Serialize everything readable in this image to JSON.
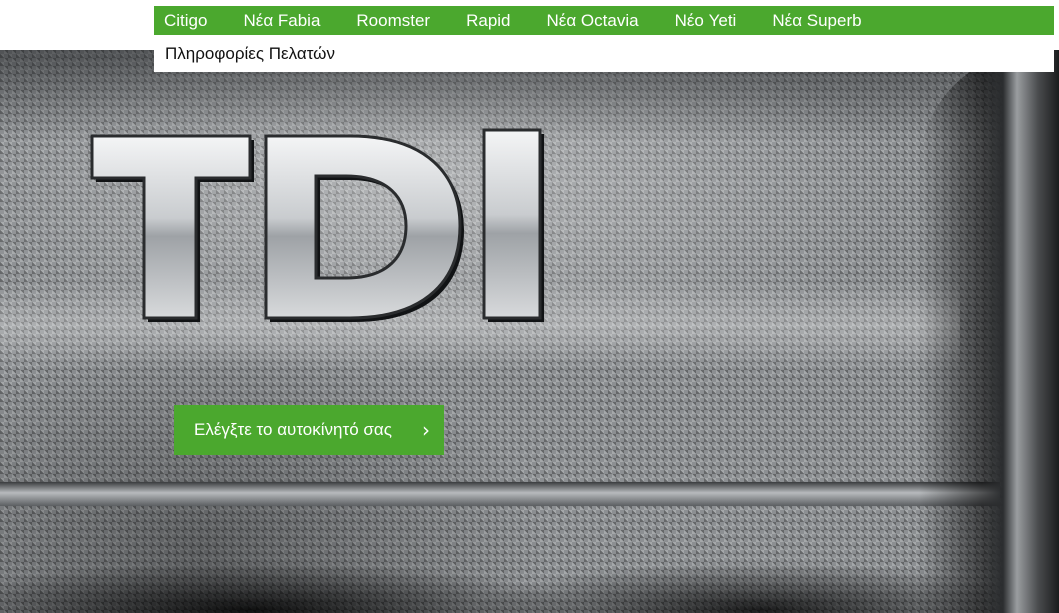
{
  "nav": {
    "items": [
      {
        "label": "Citigo"
      },
      {
        "label": "Νέα Fabia"
      },
      {
        "label": "Roomster"
      },
      {
        "label": "Rapid"
      },
      {
        "label": "Νέα Octavia"
      },
      {
        "label": "Νέο Yeti"
      },
      {
        "label": "Νέα Superb"
      }
    ],
    "sub_items": [
      {
        "label": "Πληροφορίες Πελατών"
      }
    ]
  },
  "hero": {
    "emblem_text": "TDI",
    "cta_label": "Ελέγξτε το αυτοκίνητό σας",
    "cta_icon": "chevron-right-icon"
  },
  "colors": {
    "brand_green": "#4ba82e",
    "nav_text": "#ffffff",
    "subnav_text": "#111111"
  }
}
